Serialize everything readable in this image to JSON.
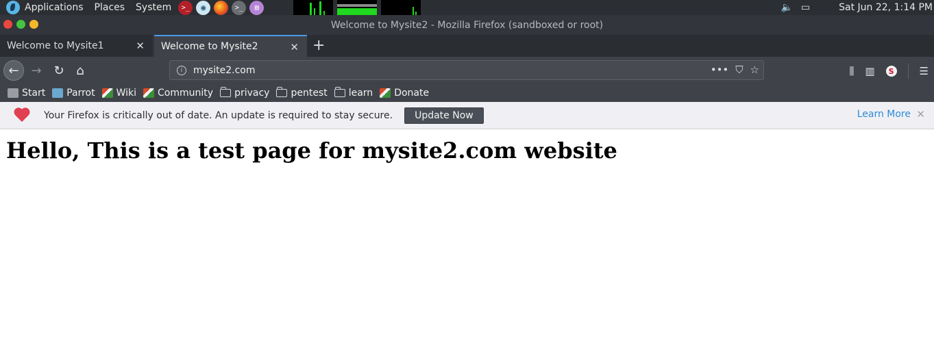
{
  "system_panel": {
    "menu": [
      "Applications",
      "Places",
      "System"
    ],
    "clock": "Sat Jun 22,  1:14 PM"
  },
  "window": {
    "title": "Welcome to Mysite2 - Mozilla Firefox (sandboxed or root)"
  },
  "tabs": [
    {
      "label": "Welcome to Mysite1",
      "active": false
    },
    {
      "label": "Welcome to Mysite2",
      "active": true
    }
  ],
  "urlbar": {
    "url": "mysite2.com"
  },
  "bookmarks": [
    "Start",
    "Parrot",
    "Wiki",
    "Community",
    "privacy",
    "pentest",
    "learn",
    "Donate"
  ],
  "notification": {
    "message": "Your Firefox is critically out of date. An update is required to stay secure.",
    "button": "Update Now",
    "link": "Learn More"
  },
  "page": {
    "heading": "Hello, This is a test page for mysite2.com website"
  }
}
